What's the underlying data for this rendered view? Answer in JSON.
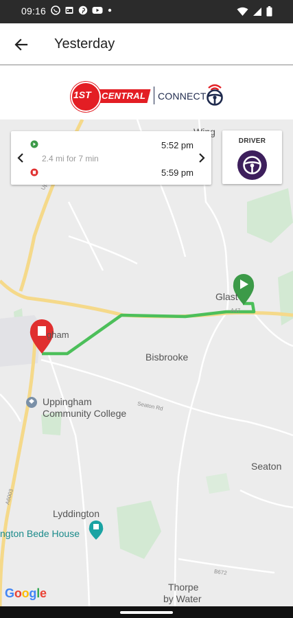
{
  "status_bar": {
    "time": "09:16",
    "left_icons": [
      "whatsapp-icon",
      "calendar-icon",
      "pinterest-icon",
      "youtube-icon",
      "dot-icon"
    ],
    "right_icons": [
      "wifi-icon",
      "signal-icon",
      "battery-icon"
    ]
  },
  "app_bar": {
    "title": "Yesterday",
    "back_icon": "arrow-back-icon"
  },
  "brand": {
    "badge_text": "1ST",
    "name_text": "CENTRAL",
    "product_text": "CONNECT",
    "brand_red": "#e31e24",
    "brand_navy": "#1f2a4d"
  },
  "trip": {
    "start_time": "5:52 pm",
    "end_time": "5:59 pm",
    "summary": "2.4 mi for 7 min",
    "route_color": "#4cbf5a"
  },
  "driver": {
    "label": "DRIVER",
    "icon": "steering-wheel-icon",
    "accent": "#3d1f5c"
  },
  "map_labels": {
    "wing": "Wing",
    "glaston": "Glast",
    "uppingham": "gham",
    "bisbrooke": "Bisbrooke",
    "college_line1": "Uppingham",
    "college_line2": "Community College",
    "seaton": "Seaton",
    "lyddington": "Lyddington",
    "bede_house": "ngton Bede House",
    "thorpe_line1": "Thorpe",
    "thorpe_line2": "by Water",
    "road_a6003_north": "Uppingham Rd",
    "road_seaton": "Seaton Rd",
    "road_a6003_south": "A6003",
    "road_b672": "B672",
    "road_glaston": "A47"
  },
  "google": {
    "letters": [
      "G",
      "o",
      "o",
      "g",
      "l",
      "e"
    ],
    "colors": [
      "#4285F4",
      "#EA4335",
      "#FBBC05",
      "#4285F4",
      "#34A853",
      "#EA4335"
    ]
  }
}
